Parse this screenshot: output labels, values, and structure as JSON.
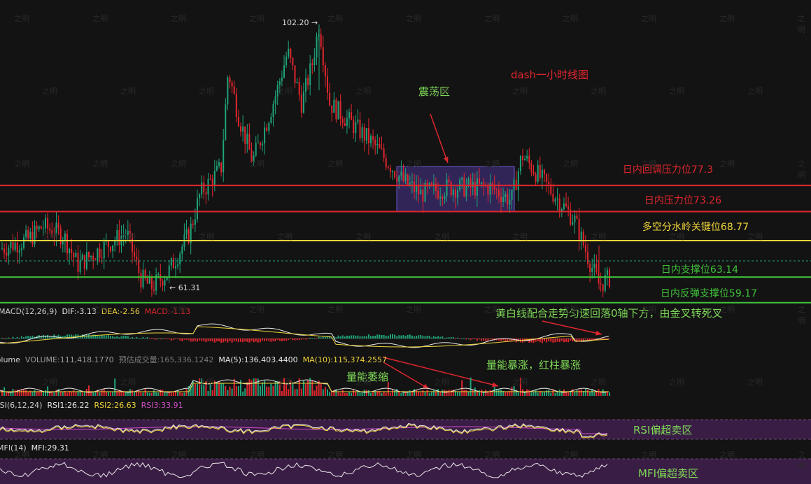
{
  "chart_data": {
    "type": "candlestick",
    "title": "dash一小时线图",
    "high_label": "102.20",
    "low_label": "61.31",
    "levels": [
      {
        "label": "日内回调压力位77.3",
        "value": 77.3,
        "color": "#e0262e"
      },
      {
        "label": "日内压力位73.26",
        "value": 73.26,
        "color": "#e0262e"
      },
      {
        "label": "多空分水岭关键位68.77",
        "value": 68.77,
        "color": "#f0d43a"
      },
      {
        "label": "日内支撑位63.14",
        "value": 63.14,
        "color": "#3fc13a"
      },
      {
        "label": "日内反弹支撑位59.17",
        "value": 59.17,
        "color": "#3fc13a"
      }
    ],
    "consolidation_zone": {
      "label": "震荡区",
      "low": 73.26,
      "high": 80.2
    },
    "annotations": [
      {
        "text": "黄白线配合走势匀速回落0轴下方，由金叉转死叉",
        "color": "#7ed957"
      },
      {
        "text": "量能暴涨，红柱暴涨",
        "color": "#7ed957"
      },
      {
        "text": "量能萎缩",
        "color": "#7ed957"
      },
      {
        "text": "RSI偏超卖区",
        "color": "#7ed957"
      },
      {
        "text": "MFI偏超卖区",
        "color": "#7ed957"
      }
    ],
    "macd": {
      "title": "MACD(12,26,9)",
      "dif": "DIF:-3.13",
      "dea": "DEA:-2.56",
      "macd": "MACD:-1.13"
    },
    "volume": {
      "title": "Volume",
      "volume": "VOLUME:111,418.1770",
      "est": "预估成交量:165,336.1242",
      "ma5": "MA(5):136,403.4400",
      "ma10": "MA(10):115,374.2557"
    },
    "rsi": {
      "title": "RSI(6,12,24)",
      "rsi1": "RSI1:26.22",
      "rsi2": "RSI2:26.63",
      "rsi3": "RSI3:33.91"
    },
    "mfi": {
      "title": "MFI(14)",
      "mfi": "MFI:29.31"
    },
    "watermark": "之明"
  }
}
